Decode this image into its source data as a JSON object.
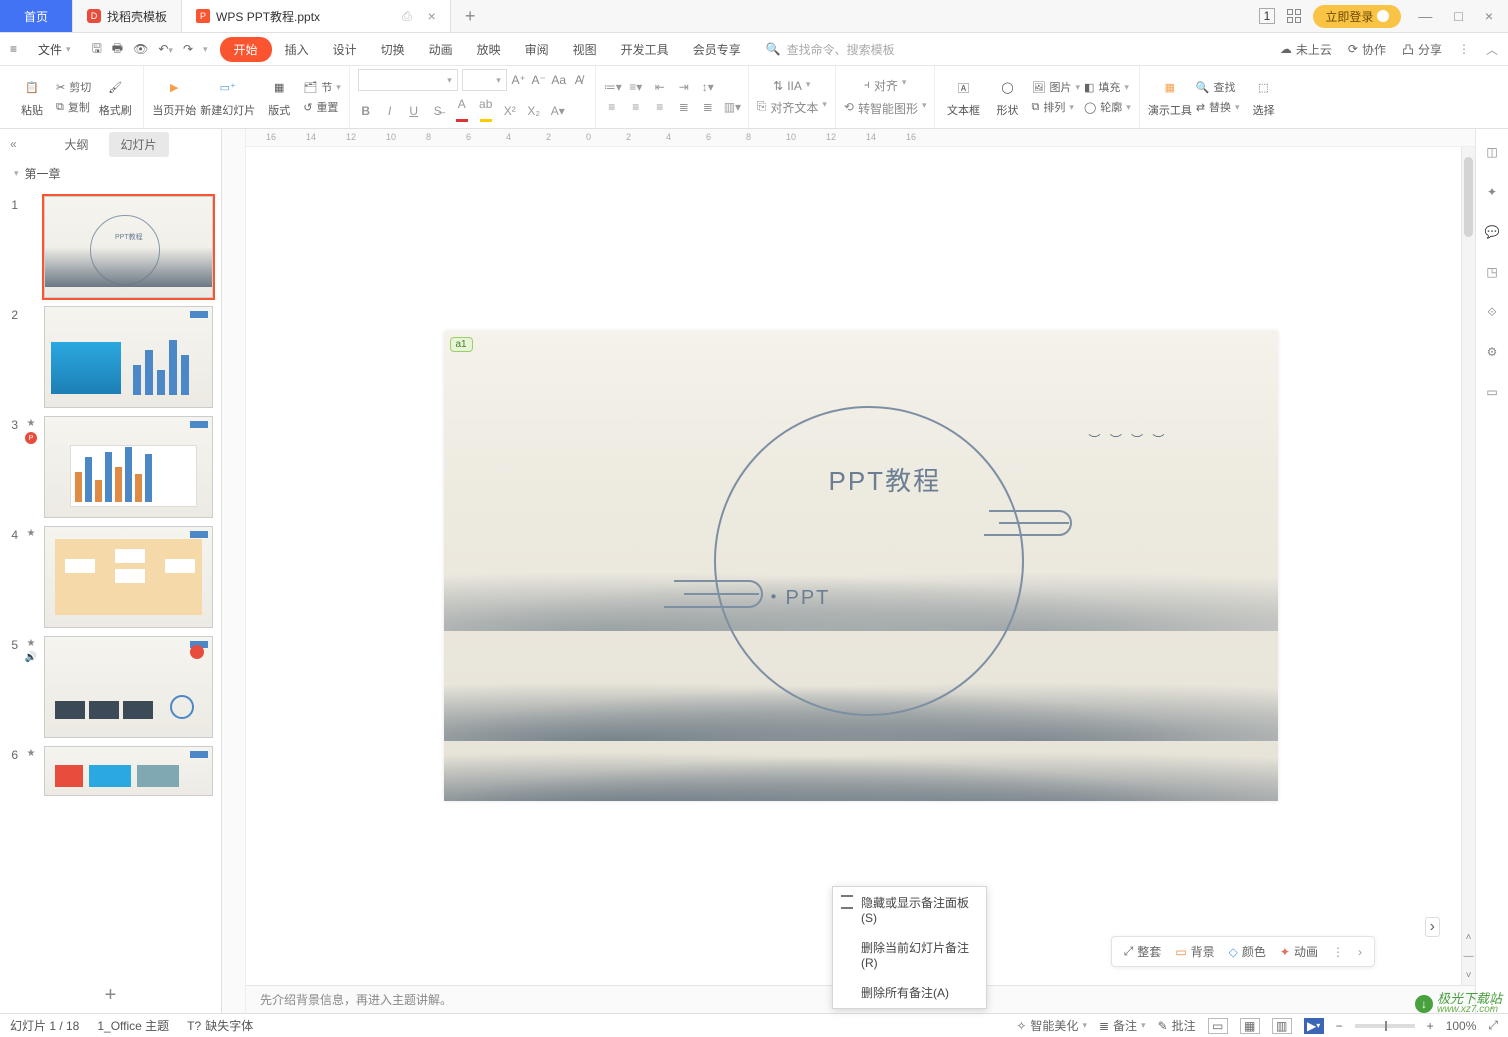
{
  "tabs": {
    "home": "首页",
    "template": "找稻壳模板",
    "file": "WPS PPT教程.pptx",
    "close": "×",
    "add": "+"
  },
  "titleRight": {
    "layout1": "1",
    "login": "立即登录",
    "min": "—",
    "max": "□",
    "close": "×"
  },
  "menu": {
    "file": "文件",
    "items": [
      "开始",
      "插入",
      "设计",
      "切换",
      "动画",
      "放映",
      "审阅",
      "视图",
      "开发工具",
      "会员专享"
    ],
    "searchPlaceholder": "查找命令、搜索模板",
    "right": {
      "cloud": "未上云",
      "coop": "协作",
      "share": "分享"
    }
  },
  "ribbon": {
    "paste": "粘贴",
    "cut": "剪切",
    "copy": "复制",
    "format": "格式刷",
    "pageStart": "当页开始",
    "newSlide": "新建幻灯片",
    "layout": "版式",
    "section": "节",
    "reset": "重置",
    "alignMenu": "对齐文本",
    "smartShape": "转智能图形",
    "textbox": "文本框",
    "shape": "形状",
    "image": "图片",
    "arrange": "排列",
    "fill": "填充",
    "outline": "轮廓",
    "presentTool": "演示工具",
    "find": "查找",
    "replace": "替换",
    "select": "选择",
    "fontDrop": "▾",
    "sizeDrop": "▾"
  },
  "panel": {
    "outline": "大纲",
    "slides": "幻灯片",
    "collapse": "«",
    "chapter": "第一章",
    "chev": "▾",
    "add": "+"
  },
  "thumbs": [
    {
      "n": "1",
      "badges": []
    },
    {
      "n": "2",
      "badges": []
    },
    {
      "n": "3",
      "badges": [
        "★",
        "P"
      ]
    },
    {
      "n": "4",
      "badges": [
        "★"
      ]
    },
    {
      "n": "5",
      "badges": [
        "★",
        "🔊"
      ]
    },
    {
      "n": "6",
      "badges": [
        "★"
      ]
    }
  ],
  "slide": {
    "commentTag": "a1",
    "title": "PPT教程",
    "sub": "・PPT",
    "birds": "︶ ︶ ︶ ︶"
  },
  "floatBar": {
    "whole": "整套",
    "bg": "背景",
    "color": "颜色",
    "anim": "动画",
    "more": "⋮",
    "next": "›"
  },
  "popup": {
    "toggle": "隐藏或显示备注面板(S)",
    "delCurrent": "删除当前幻灯片备注(R)",
    "delAll": "删除所有备注(A)"
  },
  "notes": {
    "hint": "先介绍背景信息，再进入主题讲解。"
  },
  "status": {
    "slidePos": "幻灯片 1 / 18",
    "theme": "1_Office 主题",
    "missingFont": "缺失字体",
    "beautify": "智能美化",
    "notesBtn": "备注",
    "commentBtn": "批注",
    "zoom": "100%",
    "minus": "−",
    "plus": "+",
    "drop": "▾",
    "fit": "⤢"
  },
  "watermark": {
    "site": "极光下载站",
    "url": "www.xz7.com"
  },
  "colors": {
    "accentOrange": "#fb5430",
    "accentBlue": "#4273f5"
  }
}
